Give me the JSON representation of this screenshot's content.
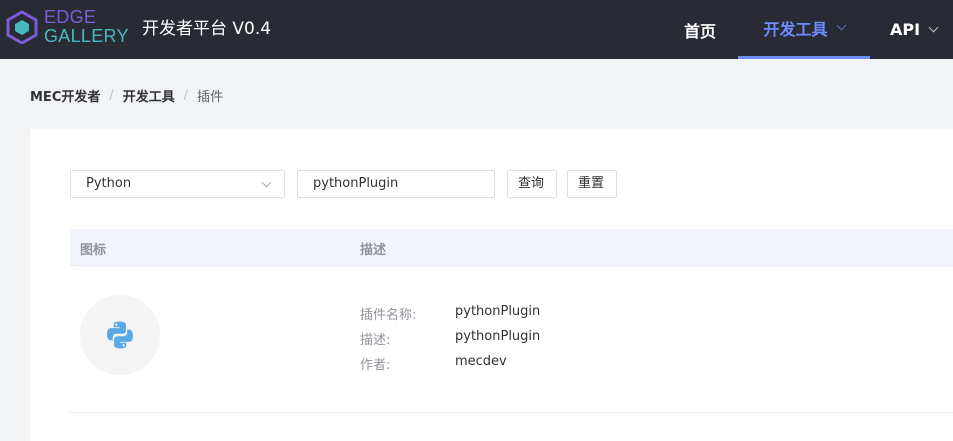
{
  "logo": {
    "line1": "EDGE",
    "line2": "GALLERY"
  },
  "platform_title": "开发者平台 V0.4",
  "nav": {
    "home": "首页",
    "dev_tools": "开发工具",
    "api": "API"
  },
  "breadcrumb": {
    "root": "MEC开发者",
    "level2": "开发工具",
    "current": "插件",
    "separator": "/"
  },
  "filters": {
    "language_selected": "Python",
    "search_value": "pythonPlugin",
    "query_button": "查询",
    "reset_button": "重置"
  },
  "table": {
    "columns": [
      "图标",
      "描述"
    ],
    "rows": [
      {
        "icon": "python-logo-icon",
        "fields": [
          {
            "key": "插件名称:",
            "value": "pythonPlugin"
          },
          {
            "key": "描述:",
            "value": "pythonPlugin"
          },
          {
            "key": "作者:",
            "value": "mecdev"
          }
        ]
      }
    ]
  },
  "colors": {
    "topbar": "#282b33",
    "accent": "#6f8cff",
    "logo_purple": "#7d5bd8",
    "logo_teal": "#46b9c0",
    "python_blue": "#5aa9e6"
  }
}
